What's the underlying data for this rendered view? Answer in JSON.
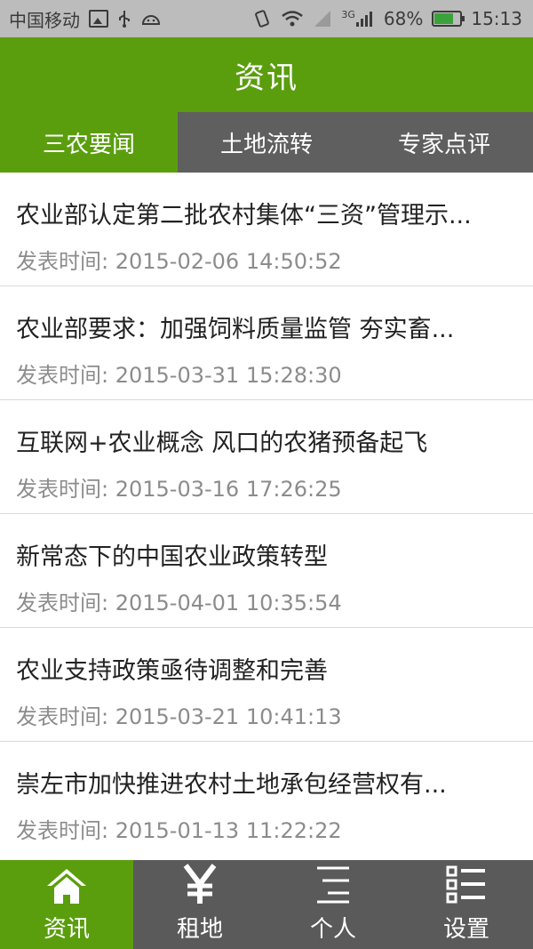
{
  "status_bar": {
    "carrier": "中国移动",
    "network": "3G",
    "battery": "68%",
    "time": "15:13",
    "icons": [
      "gallery-icon",
      "usb-icon",
      "android-icon",
      "vibrate-icon",
      "wifi-icon",
      "no-signal-icon",
      "signal-icon",
      "battery-icon"
    ]
  },
  "header": {
    "title": "资讯"
  },
  "tabs": [
    {
      "label": "三农要闻"
    },
    {
      "label": "土地流转"
    },
    {
      "label": "专家点评"
    }
  ],
  "news": [
    {
      "title": "农业部认定第二批农村集体“三资”管理示...",
      "time": "发表时间:  2015-02-06 14:50:52"
    },
    {
      "title": "农业部要求：加强饲料质量监管 夯实畜...",
      "time": "发表时间:  2015-03-31 15:28:30"
    },
    {
      "title": "互联网+农业概念 风口的农猪预备起飞",
      "time": "发表时间:  2015-03-16 17:26:25"
    },
    {
      "title": "新常态下的中国农业政策转型",
      "time": "发表时间:  2015-04-01 10:35:54"
    },
    {
      "title": "农业支持政策亟待调整和完善",
      "time": "发表时间:  2015-03-21 10:41:13"
    },
    {
      "title": "崇左市加快推进农村土地承包经营权有...",
      "time": "发表时间:  2015-01-13 11:22:22"
    }
  ],
  "bottom_nav": [
    {
      "label": "资讯",
      "icon": "home-icon"
    },
    {
      "label": "租地",
      "icon": "yuan-icon"
    },
    {
      "label": "个人",
      "icon": "person-lines-icon"
    },
    {
      "label": "设置",
      "icon": "settings-list-icon"
    }
  ],
  "colors": {
    "accent": "#5a9e0e",
    "dark": "#5a5a5a",
    "statusbar": "#bcbcbc"
  }
}
